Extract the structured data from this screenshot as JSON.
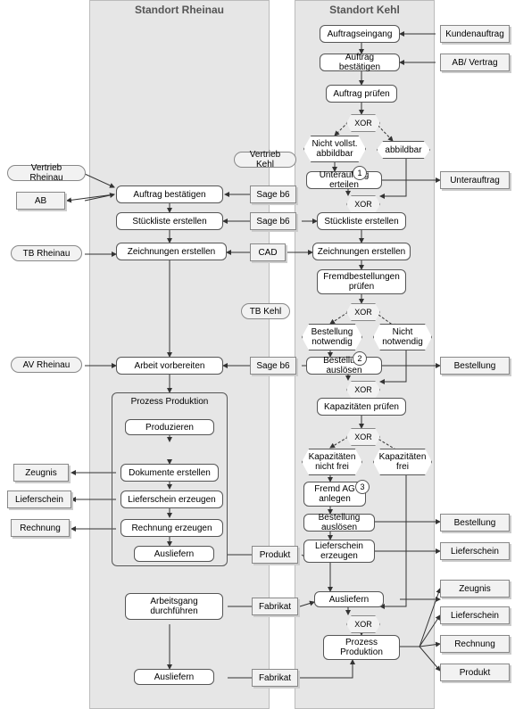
{
  "lanes": {
    "rheinau": "Standort Rheinau",
    "kehl": "Standort Kehl"
  },
  "rheinau": {
    "vertrieb": "Vertrieb Rheinau",
    "ab": "AB",
    "auftrag_best": "Auftrag bestätigen",
    "stueckliste": "Stückliste erstellen",
    "tb": "TB Rheinau",
    "zeichnungen": "Zeichnungen erstellen",
    "av": "AV Rheinau",
    "arbeit_vorb": "Arbeit vorbereiten",
    "prozess_prod": "Prozess Produktion",
    "produzieren": "Produzieren",
    "dokumente": "Dokumente erstellen",
    "lieferschein_erz": "Lieferschein erzeugen",
    "rechnung_erz": "Rechnung erzeugen",
    "ausliefern": "Ausliefern",
    "arbeitsgang": "Arbeitsgang durchführen",
    "ausliefern2": "Ausliefern",
    "zeugnis": "Zeugnis",
    "lieferschein": "Lieferschein",
    "rechnung": "Rechnung"
  },
  "mid": {
    "vertrieb_kehl": "Vertrieb Kehl",
    "sage_b6_1": "Sage b6",
    "sage_b6_2": "Sage b6",
    "cad": "CAD",
    "tb_kehl": "TB Kehl",
    "sage_b6_3": "Sage b6",
    "produkt1": "Produkt",
    "fabrikat1": "Fabrikat",
    "fabrikat2": "Fabrikat"
  },
  "kehl": {
    "auftragseingang": "Auftragseingang",
    "kundenauftrag": "Kundenauftrag",
    "auftrag_best": "Auftrag bestätigen",
    "ab_vertrag": "AB/ Vertrag",
    "auftrag_pruefen": "Auftrag prüfen",
    "nicht_abbildbar": "Nicht vollst. abbildbar",
    "abbildbar": "abbildbar",
    "unterauftrag_ert": "Unterauftrag erteilen",
    "unterauftrag": "Unterauftrag",
    "stueckliste": "Stückliste erstellen",
    "zeichnungen": "Zeichnungen erstellen",
    "fremdbest_prf": "Fremdbestellungen prüfen",
    "best_notw": "Bestellung notwendig",
    "nicht_notw": "Nicht notwendig",
    "best_ausl": "Bestellung auslösen",
    "bestellung1": "Bestellung",
    "kap_prf": "Kapazitäten prüfen",
    "kap_nfrei": "Kapazitäten nicht frei",
    "kap_frei": "Kapazitäten frei",
    "fremdag": "Fremd AG anlegen",
    "best_ausl2": "Bestellung auslösen",
    "bestellung2": "Bestellung",
    "lieferschein_erz": "Lieferschein erzeugen",
    "lieferschein2": "Lieferschein",
    "ausliefern": "Ausliefern",
    "prozess_prod": "Prozess Produktion",
    "zeugnis": "Zeugnis",
    "lieferschein3": "Lieferschein",
    "rechnung": "Rechnung",
    "produkt": "Produkt"
  },
  "xor": "XOR",
  "marks": {
    "m1": "1",
    "m2": "2",
    "m3": "3"
  }
}
